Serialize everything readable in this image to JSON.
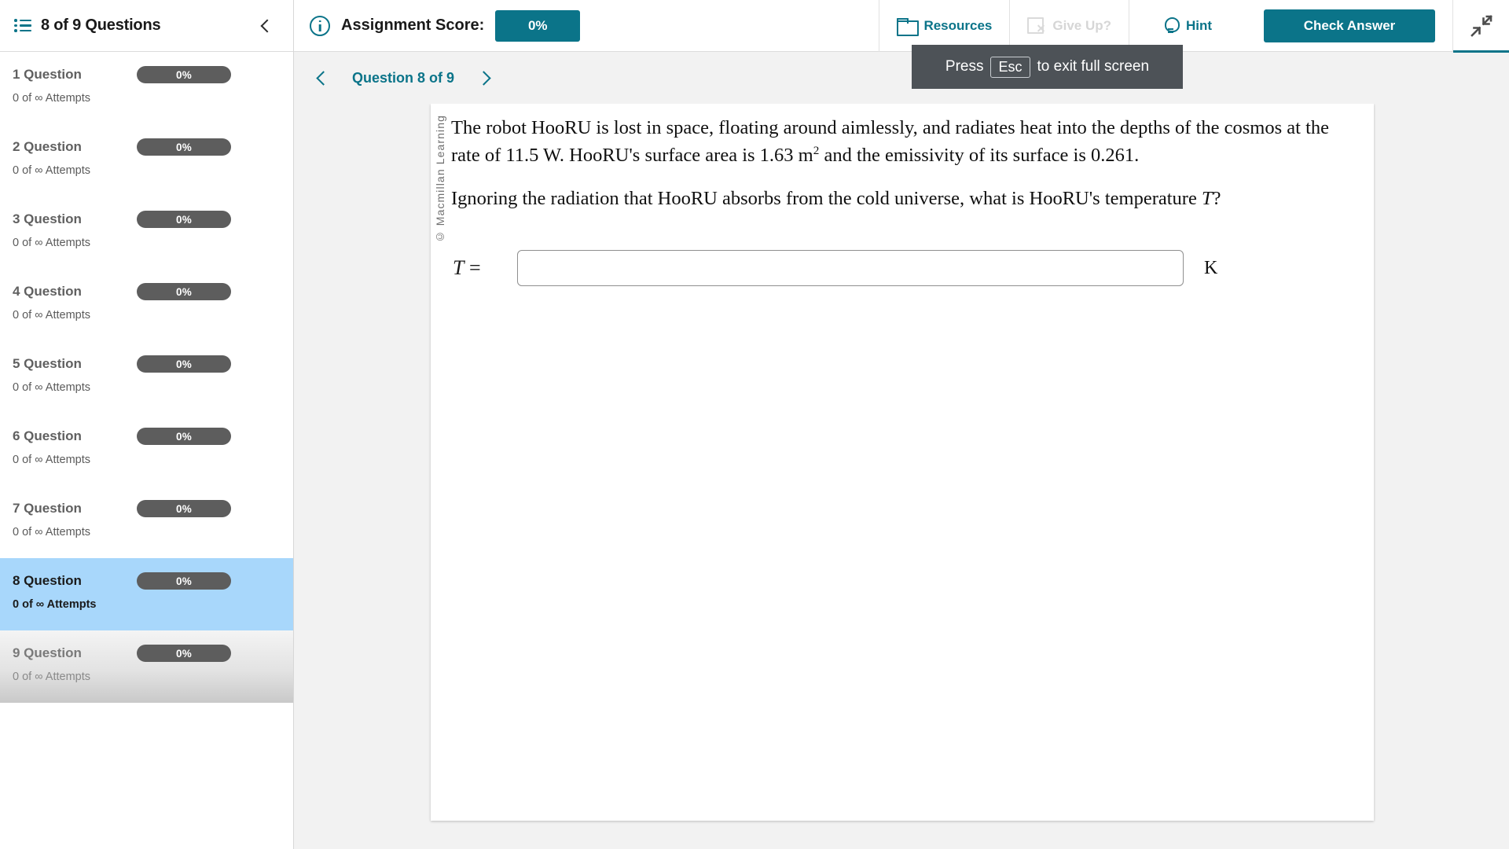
{
  "sidebar": {
    "title": "8 of 9 Questions",
    "list_icon": "list-icon",
    "collapse_icon": "chevron-left-icon",
    "items": [
      {
        "label": "1 Question",
        "score": "0%",
        "attempts": "0 of ∞ Attempts",
        "state": "normal"
      },
      {
        "label": "2 Question",
        "score": "0%",
        "attempts": "0 of ∞ Attempts",
        "state": "normal"
      },
      {
        "label": "3 Question",
        "score": "0%",
        "attempts": "0 of ∞ Attempts",
        "state": "normal"
      },
      {
        "label": "4 Question",
        "score": "0%",
        "attempts": "0 of ∞ Attempts",
        "state": "normal"
      },
      {
        "label": "5 Question",
        "score": "0%",
        "attempts": "0 of ∞ Attempts",
        "state": "normal"
      },
      {
        "label": "6 Question",
        "score": "0%",
        "attempts": "0 of ∞ Attempts",
        "state": "normal"
      },
      {
        "label": "7 Question",
        "score": "0%",
        "attempts": "0 of ∞ Attempts",
        "state": "normal"
      },
      {
        "label": "8 Question",
        "score": "0%",
        "attempts": "0 of ∞ Attempts",
        "state": "selected"
      },
      {
        "label": "9 Question",
        "score": "0%",
        "attempts": "0 of ∞ Attempts",
        "state": "locked"
      }
    ]
  },
  "topbar": {
    "info_icon": "info-icon",
    "score_label": "Assignment Score:",
    "score_value": "0%",
    "resources_label": "Resources",
    "resources_icon": "folder-icon",
    "giveup_label": "Give Up?",
    "giveup_icon": "giveup-icon",
    "hint_label": "Hint",
    "hint_icon": "lightbulb-icon",
    "check_answer_label": "Check Answer",
    "fullscreen_exit_icon": "contract-arrows-icon"
  },
  "subnav": {
    "prev_icon": "chevron-left-icon",
    "question_counter": "Question 8 of 9",
    "next_icon": "chevron-right-icon"
  },
  "tooltip": {
    "press_text": "Press",
    "key": "Esc",
    "suffix_text": "to exit full screen"
  },
  "question": {
    "copyright": "© Macmillan Learning",
    "paragraph1_part1": "The robot HooRU is lost in space, floating around aimlessly, and radiates heat into the depths of the cosmos at the rate of 11.5 W. HooRU's surface area is 1.63 m",
    "paragraph1_sup": "2",
    "paragraph1_part2": " and the emissivity of its surface is 0.261.",
    "paragraph2_part1": "Ignoring the radiation that HooRU absorbs from the cold universe, what is HooRU's temperature ",
    "paragraph2_var": "T",
    "paragraph2_part2": "?",
    "answer_variable": "T",
    "answer_equals": "=",
    "answer_value": "",
    "answer_placeholder": "",
    "answer_unit": "K"
  },
  "colors": {
    "accent": "#0b7489",
    "selected_row": "#a8d7fb",
    "pill": "#5d5d5d",
    "tooltip_bg": "#4d5257",
    "content_bg": "#f2f2f2"
  }
}
